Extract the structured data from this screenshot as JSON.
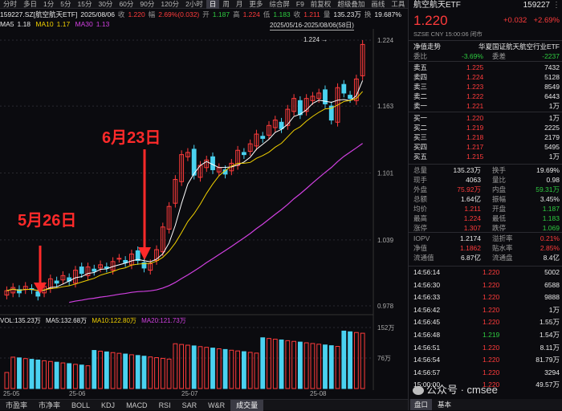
{
  "top_tabs": [
    "分时",
    "多日",
    "1分",
    "5分",
    "15分",
    "30分",
    "60分",
    "90分",
    "120分",
    "2小时",
    "日",
    "周",
    "月",
    "更多",
    "综合屏",
    "F9",
    "前复权",
    "超级叠加",
    "画线",
    "工具"
  ],
  "top_selected": "日",
  "info": {
    "code": "159227.SZ[航空航天ETF]",
    "date": "2025/08/06",
    "close_label": "收",
    "close": "1.220",
    "change_label": "幅",
    "change": "2.69%(0.032)",
    "open_label": "开",
    "open": "1.187",
    "high_label": "高",
    "high": "1.224",
    "low_label": "低",
    "low": "1.183",
    "last_label": "收",
    "last": "1.211",
    "amount_label": "量",
    "amount": "135.23万",
    "turnover_label": "换",
    "turnover": "19.687%"
  },
  "ma": {
    "ma5_label": "MA5",
    "ma5": "1.18",
    "ma10_label": "MA10",
    "ma10": "1.17",
    "ma30_label": "MA30",
    "ma30": "1.13"
  },
  "range_text": "2025/05/16-2025/08/06(58日)",
  "price_axis": [
    "1.224",
    "1.163",
    "1.101",
    "1.039",
    "0.978"
  ],
  "peak_label": "1.224",
  "annotations": [
    {
      "text": "5月26日"
    },
    {
      "text": "6月23日"
    }
  ],
  "vol_line": {
    "vol": "VOL:135.23万",
    "ma5": "MA5:132.68万",
    "ma10": "MA10:122.80万",
    "ma20": "MA20:121.73万"
  },
  "vol_axis": [
    "152万",
    "76万"
  ],
  "x_labels": [
    "25-05",
    "25-06",
    "25-07",
    "25-08"
  ],
  "bottom_tabs": [
    "市盈率",
    "市净率",
    "BOLL",
    "KDJ",
    "MACD",
    "RSI",
    "SAR",
    "W&R",
    "成交量"
  ],
  "bottom_selected": "成交量",
  "quote": {
    "name": "航空航天ETF",
    "code": "159227",
    "price": "1.220",
    "chg": "+0.032",
    "pct": "+2.69%",
    "sub": "SZSE CNY 15:00:06 闭市"
  },
  "net_tabs": {
    "left": "净值走势",
    "right": "华夏国证航天航空行业ETF"
  },
  "weibi": {
    "label1": "委比",
    "val1": "-3.69%",
    "label2": "委差",
    "val2": "-2237"
  },
  "asks": [
    {
      "l": "卖五",
      "p": "1.225",
      "v": "7432"
    },
    {
      "l": "卖四",
      "p": "1.224",
      "v": "5128"
    },
    {
      "l": "卖三",
      "p": "1.223",
      "v": "8549"
    },
    {
      "l": "卖二",
      "p": "1.222",
      "v": "6443"
    },
    {
      "l": "卖一",
      "p": "1.221",
      "v": "1万"
    }
  ],
  "bids": [
    {
      "l": "买一",
      "p": "1.220",
      "v": "1万"
    },
    {
      "l": "买二",
      "p": "1.219",
      "v": "2225"
    },
    {
      "l": "买三",
      "p": "1.218",
      "v": "2179"
    },
    {
      "l": "买四",
      "p": "1.217",
      "v": "5495"
    },
    {
      "l": "买五",
      "p": "1.215",
      "v": "1万"
    }
  ],
  "stats": [
    {
      "l1": "总量",
      "v1": "135.23万",
      "l2": "换手",
      "v2": "19.69%"
    },
    {
      "l1": "现手",
      "v1": "4063",
      "l2": "量比",
      "v2": "0.98"
    },
    {
      "l1": "外盘",
      "v1": "75.92万",
      "l2": "内盘",
      "v2": "59.31万"
    },
    {
      "l1": "总额",
      "v1": "1.64亿",
      "l2": "振幅",
      "v2": "3.45%"
    },
    {
      "l1": "均价",
      "v1": "1.211",
      "l2": "开盘",
      "v2": "1.187"
    },
    {
      "l1": "最高",
      "v1": "1.224",
      "l2": "最低",
      "v2": "1.183"
    },
    {
      "l1": "涨停",
      "v1": "1.307",
      "l2": "跌停",
      "v2": "1.069"
    }
  ],
  "iopv": [
    {
      "l1": "IOPV",
      "v1": "1.2174",
      "l2": "溢折率",
      "v2": "0.21%"
    },
    {
      "l1": "净值",
      "v1": "1.1862",
      "l2": "贴水率",
      "v2": "2.85%"
    },
    {
      "l1": "流通值",
      "v1": "6.87亿",
      "l2": "流通盘",
      "v2": "8.4亿"
    }
  ],
  "ticks": [
    {
      "t": "14:56:14",
      "p": "1.220",
      "v": "5002"
    },
    {
      "t": "14:56:30",
      "p": "1.220",
      "v": "6588"
    },
    {
      "t": "14:56:33",
      "p": "1.220",
      "v": "9888"
    },
    {
      "t": "14:56:42",
      "p": "1.220",
      "v": "1万"
    },
    {
      "t": "14:56:45",
      "p": "1.220",
      "v": "1.55万"
    },
    {
      "t": "14:56:48",
      "p": "1.219",
      "v": "1.54万"
    },
    {
      "t": "14:56:51",
      "p": "1.220",
      "v": "8.11万"
    },
    {
      "t": "14:56:54",
      "p": "1.220",
      "v": "81.79万"
    },
    {
      "t": "14:56:57",
      "p": "1.220",
      "v": "3294"
    },
    {
      "t": "15:00:00",
      "p": "1.220",
      "v": "49.57万"
    }
  ],
  "footer_tabs": {
    "a": "盘口",
    "b": "基本"
  },
  "watermark": "公众号 · cmsee",
  "colors": {
    "up": "#ff3b3b",
    "down": "#2ecc40",
    "ma5": "#ffffff",
    "ma10": "#f0d000",
    "ma30": "#d040e0",
    "flat": "#4ad2f0"
  }
}
